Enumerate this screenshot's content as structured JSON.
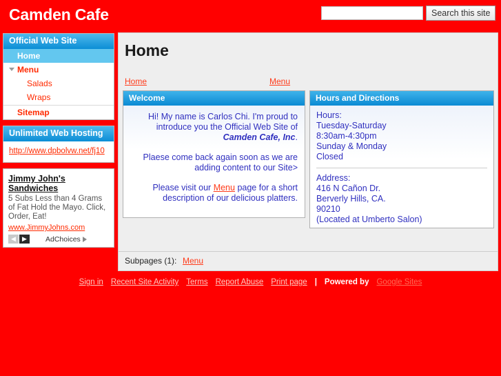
{
  "header": {
    "site_title": "Camden Cafe",
    "search_value": "",
    "search_placeholder": "",
    "search_button_label": "Search this site"
  },
  "sidebar": {
    "nav_gadget": {
      "title": "Official Web Site",
      "items": [
        {
          "label": "Home",
          "level": "top",
          "selected": true,
          "toggle": false
        },
        {
          "label": "Menu",
          "level": "top",
          "selected": false,
          "toggle": true
        },
        {
          "label": "Salads",
          "level": "sub",
          "selected": false,
          "toggle": false
        },
        {
          "label": "Wraps",
          "level": "sub",
          "selected": false,
          "toggle": false
        },
        {
          "label": "Sitemap",
          "level": "top",
          "selected": false,
          "toggle": false
        }
      ]
    },
    "ad_gadget": {
      "title": "Unlimited Web Hosting",
      "link_text": "http://www.dpbolvw.net/fj10"
    },
    "ad_block": {
      "title": "Jimmy John's Sandwiches",
      "body": "5 Subs Less than 4 Grams of Fat Hold the Mayo. Click, Order, Eat!",
      "url": "www.JimmyJohns.com",
      "prev_icon": "chevron-left-icon",
      "next_icon": "chevron-right-icon",
      "adchoices_label": "AdChoices"
    }
  },
  "main": {
    "page_title": "Home",
    "breadcrumb_home": "Home",
    "breadcrumb_menu": "Menu",
    "welcome": {
      "title": "Welcome",
      "p1_a": "Hi! My name is Carlos Chi. I'm proud to introduce you the Official Web Site of ",
      "p1_brand": "Camden Cafe, Inc",
      "p1_b": ".",
      "p2": "Plaese come back again soon as we are adding content to our Site>",
      "p3_a": "Please visit our ",
      "p3_link": "Menu",
      "p3_b": " page for a short description of our delicious platters."
    },
    "hours": {
      "title": "Hours and Directions",
      "lines": [
        "Hours:",
        "Tuesday-Saturday",
        "8:30am-4:30pm",
        "Sunday & Monday",
        "Closed"
      ],
      "address_lines": [
        "Address:",
        "416 N Cañon Dr.",
        "Berverly Hills, CA.",
        "90210",
        "(Located at Umberto Salon)"
      ]
    },
    "subpages_label": "Subpages (1):",
    "subpages_link": "Menu"
  },
  "footer": {
    "links": [
      "Sign in",
      "Recent Site Activity",
      "Terms",
      "Report Abuse",
      "Print page"
    ],
    "divider": "|",
    "powered_by": "Powered by",
    "powered_brand": "Google Sites"
  },
  "colors": {
    "brand_red": "#ff0000",
    "link_red": "#ff3b1a",
    "panel_blue": "#0a8ad3",
    "nav_selected": "#63c7ef",
    "body_text_blue": "#2f2fbf"
  }
}
